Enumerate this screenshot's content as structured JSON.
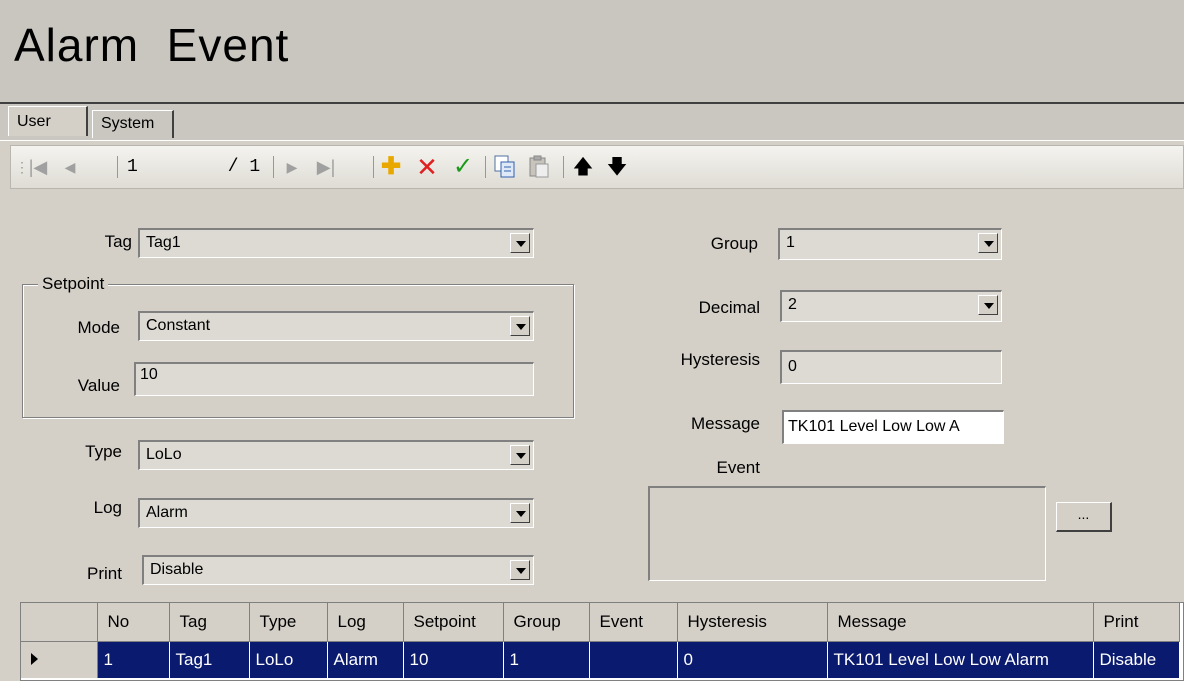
{
  "window": {
    "title": "Alarm  Event"
  },
  "tabs": [
    {
      "label": "User"
    },
    {
      "label": "System"
    }
  ],
  "toolbar": {
    "record_current": "1",
    "record_total": "/ 1"
  },
  "form": {
    "tag": {
      "label": "Tag",
      "value": "Tag1"
    },
    "setpoint_label": "Setpoint",
    "mode": {
      "label": "Mode",
      "value": "Constant"
    },
    "value": {
      "label": "Value",
      "value": "10"
    },
    "type": {
      "label": "Type",
      "value": "LoLo"
    },
    "log": {
      "label": "Log",
      "value": "Alarm"
    },
    "print": {
      "label": "Print",
      "value": "Disable"
    },
    "group": {
      "label": "Group",
      "value": "1"
    },
    "decimal": {
      "label": "Decimal",
      "value": "2"
    },
    "hysteresis": {
      "label": "Hysteresis",
      "value": "0"
    },
    "message": {
      "label": "Message",
      "value": "TK101 Level Low Low A"
    },
    "event": {
      "label": "Event",
      "button": "..."
    }
  },
  "grid": {
    "columns": [
      "No",
      "Tag",
      "Type",
      "Log",
      "Setpoint",
      "Group",
      "Event",
      "Hysteresis",
      "Message",
      "Print"
    ],
    "rows": [
      {
        "no": "1",
        "tag": "Tag1",
        "type": "LoLo",
        "log": "Alarm",
        "setpoint": "10",
        "group": "1",
        "event": "",
        "hysteresis": "0",
        "message": "TK101 Level Low Low Alarm",
        "print": "Disable"
      }
    ]
  },
  "colors": {
    "selection": "#0a1a6e",
    "background": "#d4d0c8",
    "add_icon": "#e8a800",
    "delete_icon": "#e02020",
    "check_icon": "#1a9a1a"
  },
  "icons": [
    "first-record-icon",
    "prev-record-icon",
    "next-record-icon",
    "last-record-icon",
    "add-icon",
    "delete-icon",
    "check-icon",
    "copy-icon",
    "paste-icon",
    "move-up-icon",
    "move-down-icon"
  ]
}
